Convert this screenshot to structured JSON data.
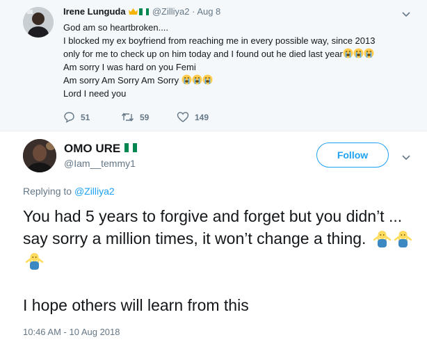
{
  "parent_tweet": {
    "name": "Irene Lunguda",
    "handle": "@Zilliya2",
    "date": "· Aug 8",
    "lines": [
      "God am so heartbroken....",
      "I blocked my ex boyfriend from reaching me in every possible way, since 2013",
      "only for me to check up on him today and I found out he died last year",
      "Am sorry I was hard on you Femi",
      "Am sorry Am Sorry Am Sorry",
      "Lord I need you"
    ],
    "replies": "51",
    "retweets": "59",
    "likes": "149"
  },
  "main_tweet": {
    "name": "OMO URE",
    "handle": "@Iam__temmy1",
    "follow_label": "Follow",
    "replying_prefix": "Replying to",
    "replying_handle": "@Zilliya2",
    "text_line1": "You had 5 years to forgive and forget but you didn’t ... say sorry a million times, it won’t change a thing.",
    "text_line2": "I hope others will learn from this",
    "timestamp": "10:46 AM - 10 Aug 2018"
  },
  "icons": {
    "parent_emoji": "loudly-crying-face",
    "main_emoji": "person-shrugging",
    "flag": "nigeria-flag",
    "crown": "crown-icon"
  },
  "colors": {
    "accent": "#1da1f2",
    "secondary_text": "#657786",
    "parent_bg": "#f5f8fa",
    "flag_green": "#008751"
  }
}
